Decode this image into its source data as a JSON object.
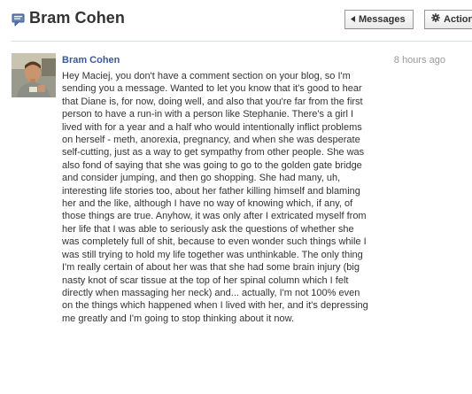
{
  "header": {
    "title": "Bram Cohen",
    "icon": "message-thread-icon"
  },
  "toolbar": {
    "messages_label": "Messages",
    "messages_icon": "back-arrow-icon",
    "actions_label": "Actions",
    "actions_icon": "gear-icon"
  },
  "message": {
    "author": "Bram Cohen",
    "timestamp": "8 hours ago",
    "avatar": "user-avatar",
    "body": "Hey Maciej, you don't have a comment section on your blog, so I'm sending you a message. Wanted to let you know that it's good to hear that Diane is, for now, doing well, and also that you're far from the first person to have a run-in with a person like Stephanie. There's a girl I lived with for a year and a half who would intentionally inflict problems on herself - meth, anorexia, pregnancy, and when she was desperate self-cutting, just as a way to get sympathy from other people. She was also fond of saying that she was going to go to the golden gate bridge and consider jumping, and then go shopping. She had many, uh, interesting life stories too, about her father killing himself and blaming her and the like, although I have no way of knowing which, if any, of those things are true. Anyhow, it was only after I extricated myself from her life that I was able to seriously ask the questions of whether she was completely full of shit, because to even wonder such things while I was still trying to hold my life together was unthinkable. The only thing I'm really certain of about her was that she had some brain injury (big nasty knot of scar tissue at the top of her spinal column which I felt directly when massaging her neck) and... actually, I'm not 100% even on the things which happened when I lived with her, and it's depressing me greatly and I'm going to stop thinking about it now."
  }
}
